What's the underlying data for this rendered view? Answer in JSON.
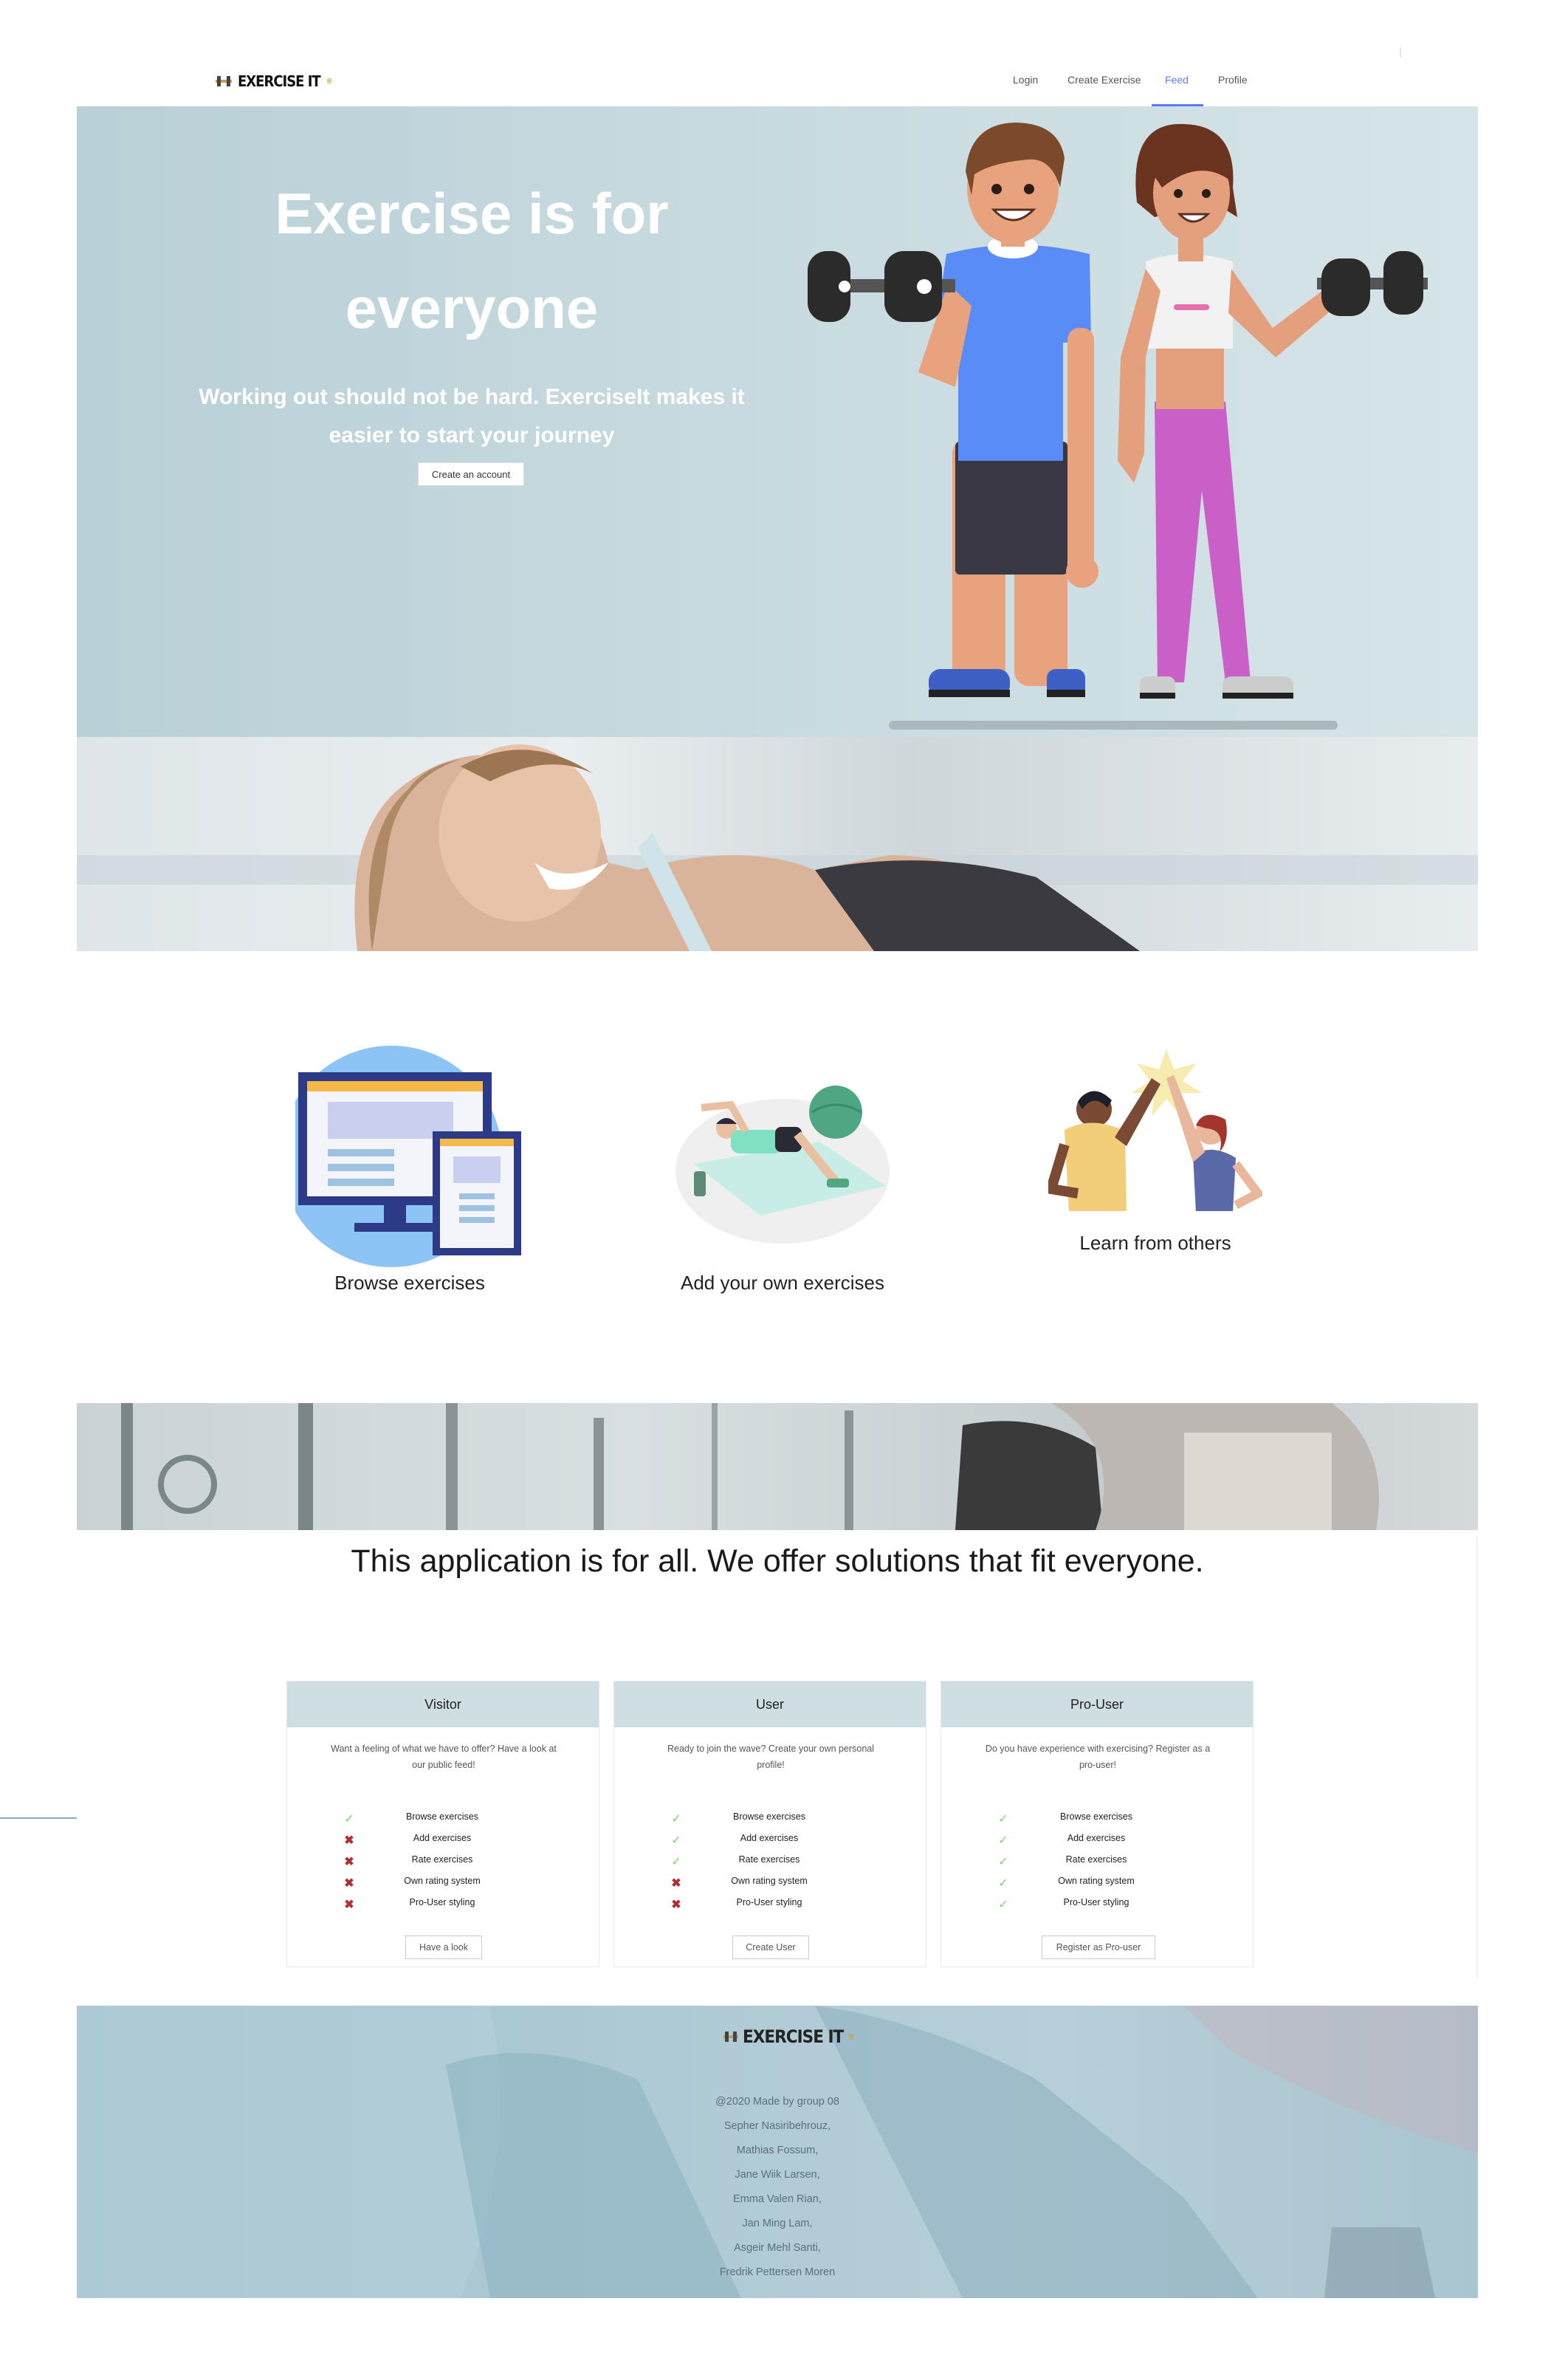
{
  "nav": {
    "brand": "EXERCISE IT",
    "brand_mark": "®",
    "links": [
      "Login",
      "Create Exercise",
      "Feed",
      "Profile"
    ],
    "active": "Feed"
  },
  "hero": {
    "title_line1": "Exercise is for",
    "title_line2": "everyone",
    "subtitle_line1": "Working out should not be hard. ExerciseIt makes it",
    "subtitle_line2": "easier to start your journey",
    "cta": "Create an account"
  },
  "features": [
    {
      "label": "Browse exercises",
      "icon": "monitor-tablet-icon"
    },
    {
      "label": "Add your own exercises",
      "icon": "yoga-mat-icon"
    },
    {
      "label": "Learn from others",
      "icon": "high-five-icon"
    }
  ],
  "tagline": "This application is for all. We offer solutions that fit everyone.",
  "plans": [
    {
      "name": "Visitor",
      "desc_line1": "Want a feeling of what we have to offer? Have a look at",
      "desc_line2": "our public feed!",
      "features": [
        {
          "label": "Browse exercises",
          "included": true
        },
        {
          "label": "Add exercises",
          "included": false
        },
        {
          "label": "Rate exercises",
          "included": false
        },
        {
          "label": "Own rating system",
          "included": false
        },
        {
          "label": "Pro-User styling",
          "included": false
        }
      ],
      "button": "Have a look"
    },
    {
      "name": "User",
      "desc_line1": "Ready to join the wave? Create your own personal",
      "desc_line2": "profile!",
      "features": [
        {
          "label": "Browse exercises",
          "included": true
        },
        {
          "label": "Add exercises",
          "included": true
        },
        {
          "label": "Rate exercises",
          "included": true
        },
        {
          "label": "Own rating system",
          "included": false
        },
        {
          "label": "Pro-User styling",
          "included": false
        }
      ],
      "button": "Create User"
    },
    {
      "name": "Pro-User",
      "desc_line1": "Do you have experience with exercising? Register as a",
      "desc_line2": "pro-user!",
      "features": [
        {
          "label": "Browse exercises",
          "included": true
        },
        {
          "label": "Add exercises",
          "included": true
        },
        {
          "label": "Rate exercises",
          "included": true
        },
        {
          "label": "Own rating system",
          "included": true
        },
        {
          "label": "Pro-User styling",
          "included": true
        }
      ],
      "button": "Register as Pro-user"
    }
  ],
  "footer": {
    "brand": "EXERCISE IT",
    "brand_mark": "®",
    "credits": [
      "@2020 Made by group 08",
      "Sepher Nasiribehrouz,",
      "Mathias Fossum,",
      "Jane Wiik Larsen,",
      "Emma Valen Rian,",
      "Jan Ming Lam,",
      "Asgeir Mehl Santi,",
      "Fredrik Pettersen Moren"
    ]
  },
  "colors": {
    "accent": "#5b7cfa",
    "hero_bg": "#c7dadf",
    "card_header": "#cfdee3",
    "check": "#7bd66a",
    "cross": "#b03030"
  }
}
